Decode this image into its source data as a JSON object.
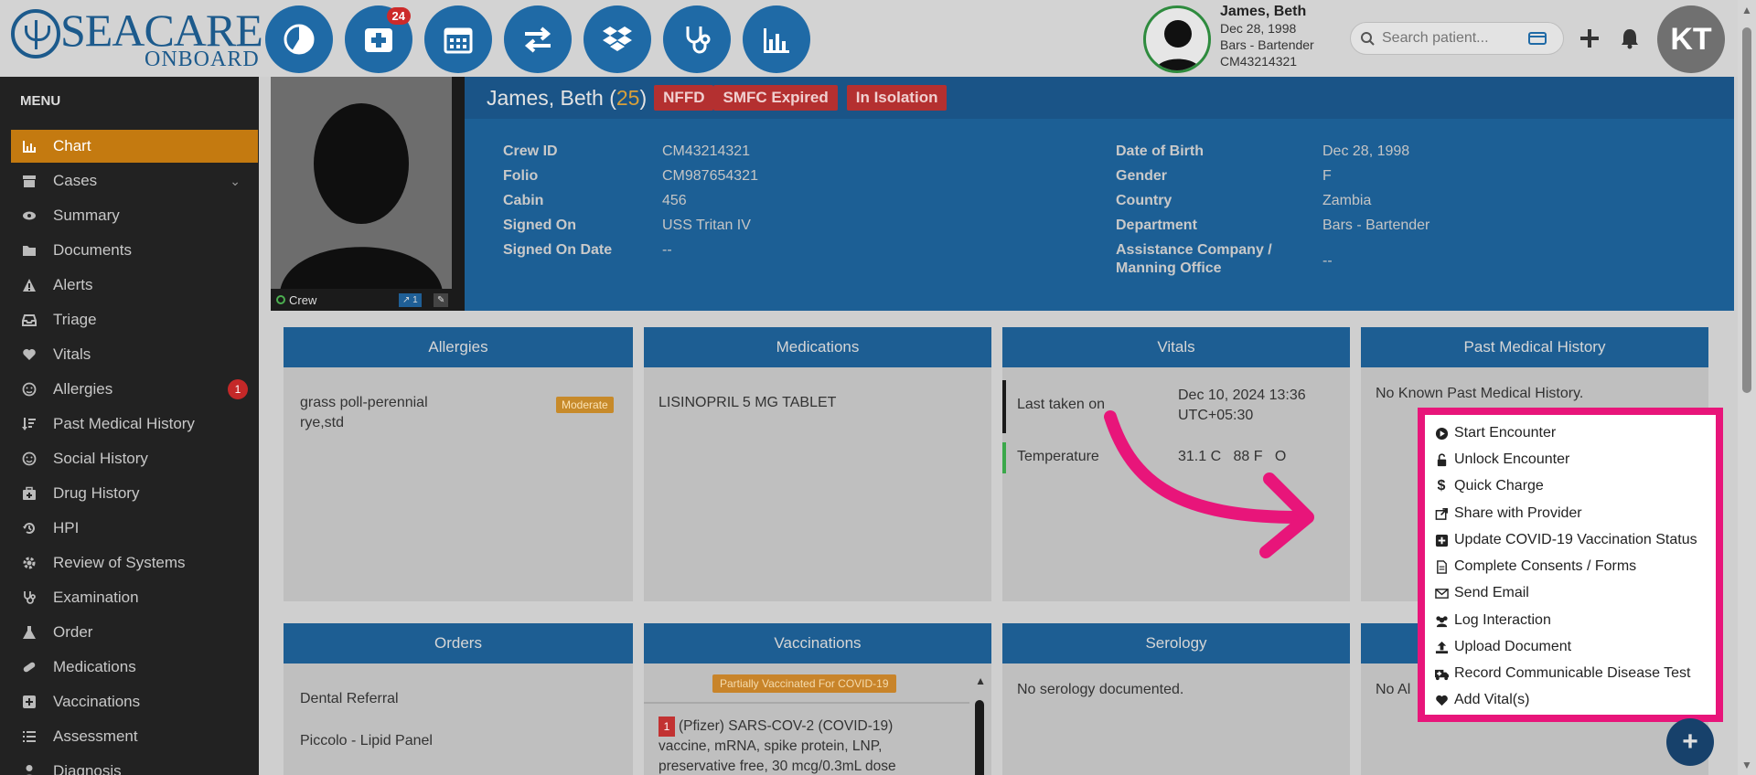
{
  "brand": {
    "name": "SEACARE",
    "sub": "ONBOARD"
  },
  "topbar": {
    "nav_badge": "24",
    "patient": {
      "name": "James, Beth",
      "dob": "Dec 28, 1998",
      "dept": "Bars - Bartender",
      "id": "CM43214321"
    },
    "search_placeholder": "Search patient...",
    "user_initials": "KT"
  },
  "sidebar": {
    "title": "MENU",
    "items": [
      {
        "label": "Chart",
        "icon": "bar-chart-icon"
      },
      {
        "label": "Cases",
        "icon": "archive-icon"
      },
      {
        "label": "Summary",
        "icon": "eye-icon"
      },
      {
        "label": "Documents",
        "icon": "folder-icon"
      },
      {
        "label": "Alerts",
        "icon": "warning-icon"
      },
      {
        "label": "Triage",
        "icon": "inbox-icon"
      },
      {
        "label": "Vitals",
        "icon": "heart-icon"
      },
      {
        "label": "Allergies",
        "icon": "face-icon",
        "count": "1"
      },
      {
        "label": "Past Medical History",
        "icon": "sort-icon"
      },
      {
        "label": "Social History",
        "icon": "smile-icon"
      },
      {
        "label": "Drug History",
        "icon": "medkit-icon"
      },
      {
        "label": "HPI",
        "icon": "history-icon"
      },
      {
        "label": "Review of Systems",
        "icon": "cog-icon"
      },
      {
        "label": "Examination",
        "icon": "stethoscope-icon"
      },
      {
        "label": "Order",
        "icon": "flask-icon"
      },
      {
        "label": "Medications",
        "icon": "pill-icon"
      },
      {
        "label": "Vaccinations",
        "icon": "plus-square-icon"
      },
      {
        "label": "Assessment",
        "icon": "list-icon"
      },
      {
        "label": "Diagnosis",
        "icon": "user-md-icon"
      }
    ]
  },
  "patient": {
    "name": "James, Beth (",
    "age": "25",
    "age_close": ")",
    "tags": [
      "NFFD",
      "SMFC Expired",
      "In Isolation"
    ],
    "photo_status": "Crew",
    "photo_count": "1",
    "left_fields": [
      {
        "label": "Crew ID",
        "value": "CM43214321"
      },
      {
        "label": "Folio",
        "value": "CM987654321"
      },
      {
        "label": "Cabin",
        "value": "456"
      },
      {
        "label": "Signed On",
        "value": "USS Tritan IV"
      },
      {
        "label": "Signed On Date",
        "value": "--"
      }
    ],
    "right_fields": [
      {
        "label": "Date of Birth",
        "value": "Dec 28, 1998"
      },
      {
        "label": "Gender",
        "value": "F"
      },
      {
        "label": "Country",
        "value": "Zambia"
      },
      {
        "label": "Department",
        "value": "Bars - Bartender"
      }
    ],
    "assist_label_1": "Assistance Company /",
    "assist_label_2": "Manning Office",
    "assist_value": "--"
  },
  "cards": {
    "allergies": {
      "title": "Allergies",
      "line1": "grass poll-perennial",
      "line2": "rye,std",
      "severity": "Moderate"
    },
    "medications": {
      "title": "Medications",
      "item": "LISINOPRIL 5 MG TABLET"
    },
    "vitals": {
      "title": "Vitals",
      "last_label": "Last taken on",
      "last_value1": "Dec 10, 2024 13:36",
      "last_value2": "UTC+05:30",
      "temp_label": "Temperature",
      "temp_value": "31.1 C   88 F   O"
    },
    "pmh": {
      "title": "Past Medical History",
      "text": "No Known Past Medical History."
    },
    "orders": {
      "title": "Orders",
      "item1": "Dental Referral",
      "item2": "Piccolo - Lipid Panel"
    },
    "vaccinations": {
      "title": "Vaccinations",
      "status": "Partially Vaccinated For COVID-19",
      "dose_num": "1",
      "line1": "(Pfizer) SARS-COV-2 (COVID-19)",
      "line2": "vaccine, mRNA, spike protein, LNP,",
      "line3": "preservative free, 30 mcg/0.3mL dose"
    },
    "serology": {
      "title": "Serology",
      "text": "No serology documented."
    },
    "fourth": {
      "text": "No Al"
    }
  },
  "action_menu": [
    {
      "label": "Start Encounter",
      "icon": "play-circle-icon"
    },
    {
      "label": "Unlock Encounter",
      "icon": "unlock-icon"
    },
    {
      "label": "Quick Charge",
      "icon": "dollar-icon"
    },
    {
      "label": "Share with Provider",
      "icon": "share-icon"
    },
    {
      "label": "Update COVID-19 Vaccination Status",
      "icon": "plus-square-icon"
    },
    {
      "label": "Complete Consents / Forms",
      "icon": "file-icon"
    },
    {
      "label": "Send Email",
      "icon": "envelope-icon"
    },
    {
      "label": "Log Interaction",
      "icon": "users-icon"
    },
    {
      "label": "Upload Document",
      "icon": "upload-icon"
    },
    {
      "label": "Record Communicable Disease Test",
      "icon": "ambulance-icon"
    },
    {
      "label": "Add Vital(s)",
      "icon": "heart-icon"
    }
  ],
  "colors": {
    "accent": "#e8157a",
    "nav_blue": "#1f6aa6",
    "active": "#c47a10"
  }
}
